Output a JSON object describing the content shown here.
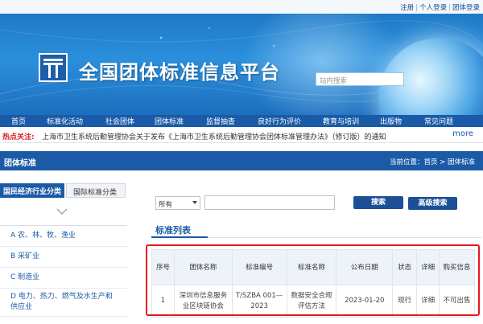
{
  "top_links": [
    "注册",
    "个人登录",
    "团体登录"
  ],
  "site": {
    "title": "全国团体标准信息平台",
    "search_placeholder": "站内搜索"
  },
  "nav": [
    "首页",
    "标准化活动",
    "社会团体",
    "团体标准",
    "监督抽查",
    "良好行为评价",
    "教育与培训",
    "出版物",
    "常见问题"
  ],
  "notice": {
    "label": "热点关注:",
    "text": "上海市卫生系统后勤管理协会关于发布《上海市卫生系统后勤管理协会团体标准管理办法》（修订版）的通知",
    "more": "more"
  },
  "section": {
    "title": "团体标准",
    "breadcrumb": "当前位置：首页 > 团体标准"
  },
  "sidebar": {
    "tabs": [
      "国民经济行业分类",
      "国际标准分类"
    ],
    "items": [
      "A 农、林、牧、渔业",
      "B 采矿业",
      "C 制造业",
      "D 电力、热力、燃气及水生产和供应业"
    ]
  },
  "search": {
    "select_value": "所有",
    "search_button": "搜索",
    "advanced_button": "高级搜索"
  },
  "list": {
    "title": "标准列表",
    "headers": [
      "序号",
      "团体名称",
      "标准编号",
      "标准名称",
      "公布日期",
      "状态",
      "详细",
      "购买信息"
    ],
    "rows": [
      {
        "index": "1",
        "org": "深圳市信息服务业区块链协会",
        "code": "T/SZBA 001—2023",
        "name": "数据安全合规评估方法",
        "date": "2023-01-20",
        "status": "现行",
        "detail": "详细",
        "purchase": "不可出售"
      }
    ]
  },
  "colors": {
    "primary": "#1b5aa6",
    "nav": "#1a5aa8",
    "alert": "#d8232a",
    "highlight_border": "#e8161f"
  }
}
